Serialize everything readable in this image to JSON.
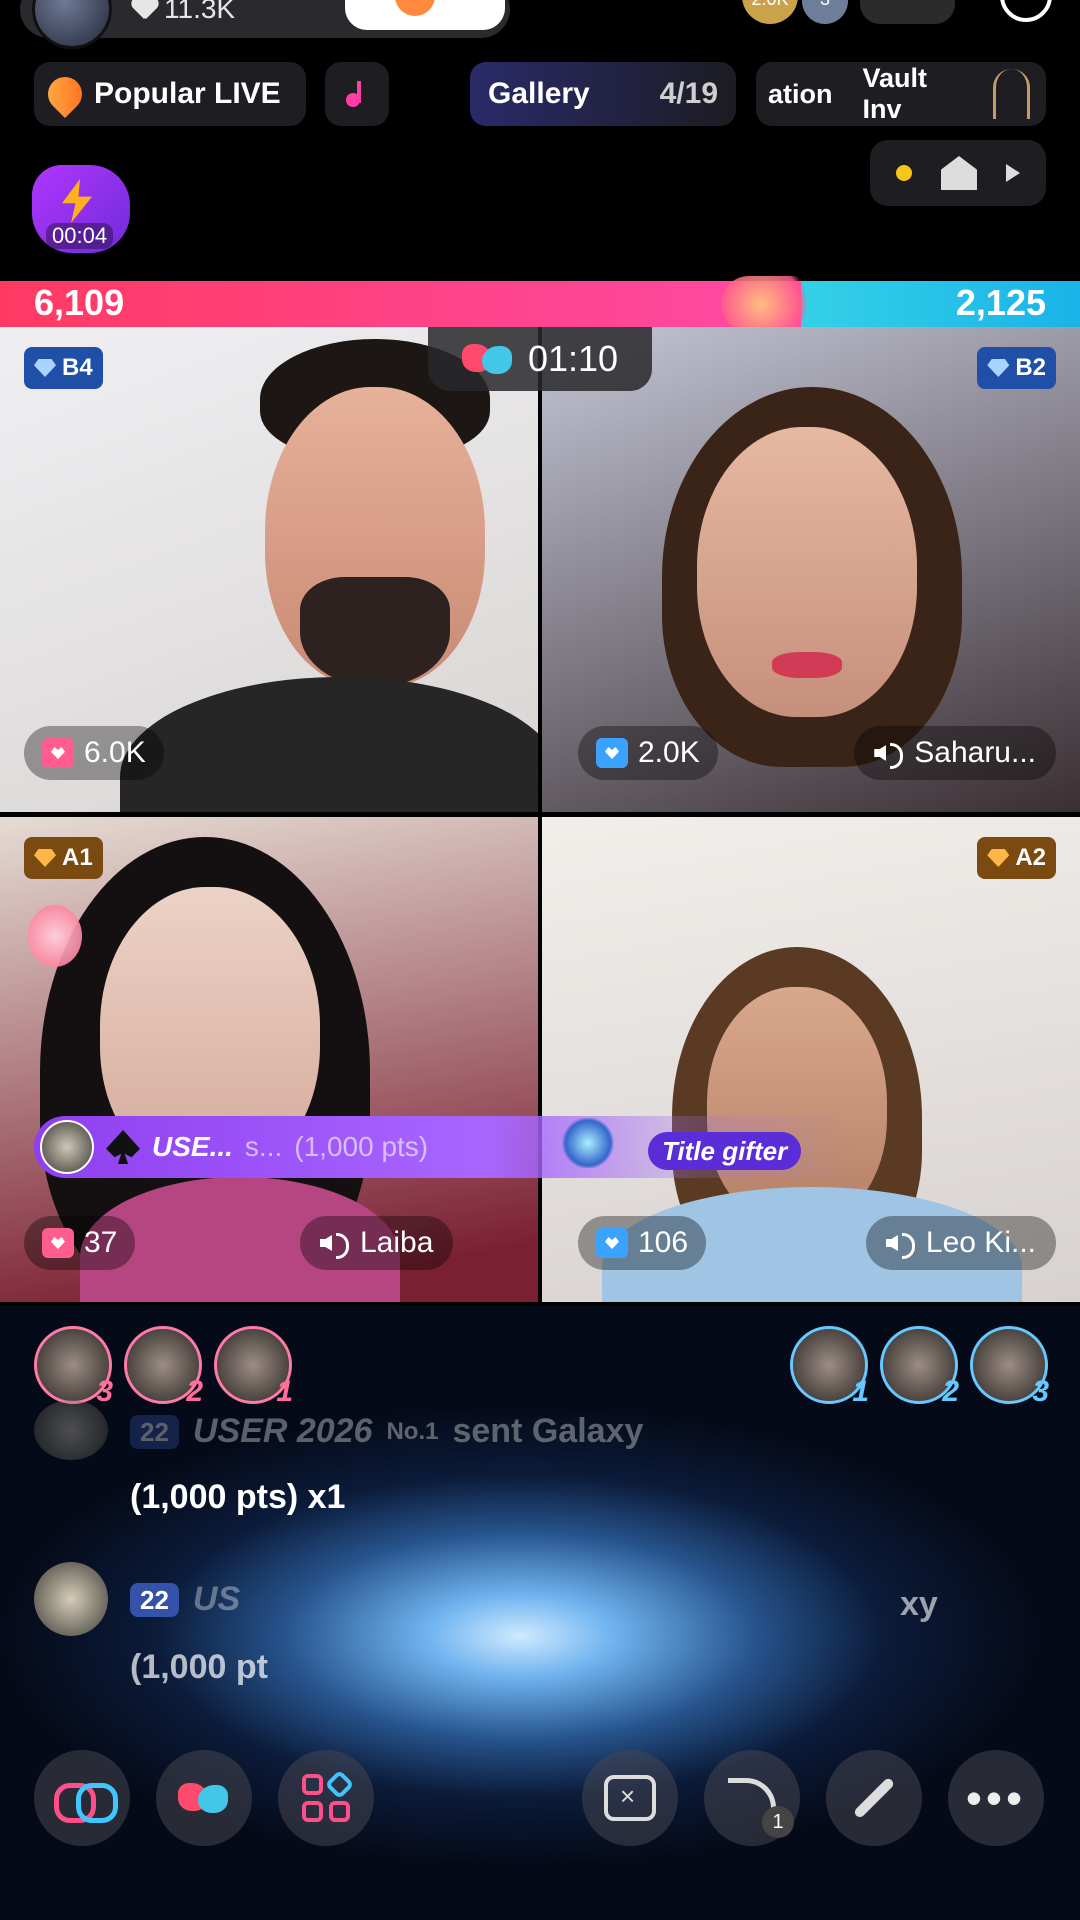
{
  "header": {
    "likes": "11.3K",
    "coins": [
      "2.0K",
      "3"
    ],
    "popular_label": "Popular LIVE",
    "gallery_label": "Gallery",
    "gallery_count": "4/19",
    "vault_label_1": "ation",
    "vault_label_2": "Vault Inv",
    "boost_timer": "00:04"
  },
  "battle": {
    "score_left": "6,109",
    "score_right": "2,125",
    "timer": "01:10",
    "left_share": 0.742
  },
  "tiles": [
    {
      "rank": "B4",
      "gifts": "6.0K",
      "name": ""
    },
    {
      "rank": "B2",
      "gifts": "2.0K",
      "name": "Saharu..."
    },
    {
      "rank": "A1",
      "gifts": "37",
      "name": "Laiba"
    },
    {
      "rank": "A2",
      "gifts": "106",
      "name": "Leo Ki..."
    }
  ],
  "gift_banner": {
    "user": "USE...",
    "text": "s...",
    "points": "(1,000 pts)",
    "title_tag": "Title gifter"
  },
  "top_gifters_left": [
    "3",
    "2",
    "1"
  ],
  "top_gifters_right": [
    "1",
    "2",
    "3"
  ],
  "chat": {
    "msg1_level": "22",
    "msg1_user": "USER 2026",
    "msg1_rank": "No.1",
    "msg1_text": "sent Galaxy",
    "msg1_line2": "(1,000 pts) x1",
    "msg2_level": "22",
    "msg2_user": "US",
    "msg2_tail": "xy",
    "msg2_line2": "(1,000 pt"
  },
  "toolbar": {
    "share_count": "1"
  },
  "colors": {
    "team_red": "#ff3a62",
    "team_blue": "#35d0e8",
    "accent_purple": "#8f3ff0"
  }
}
